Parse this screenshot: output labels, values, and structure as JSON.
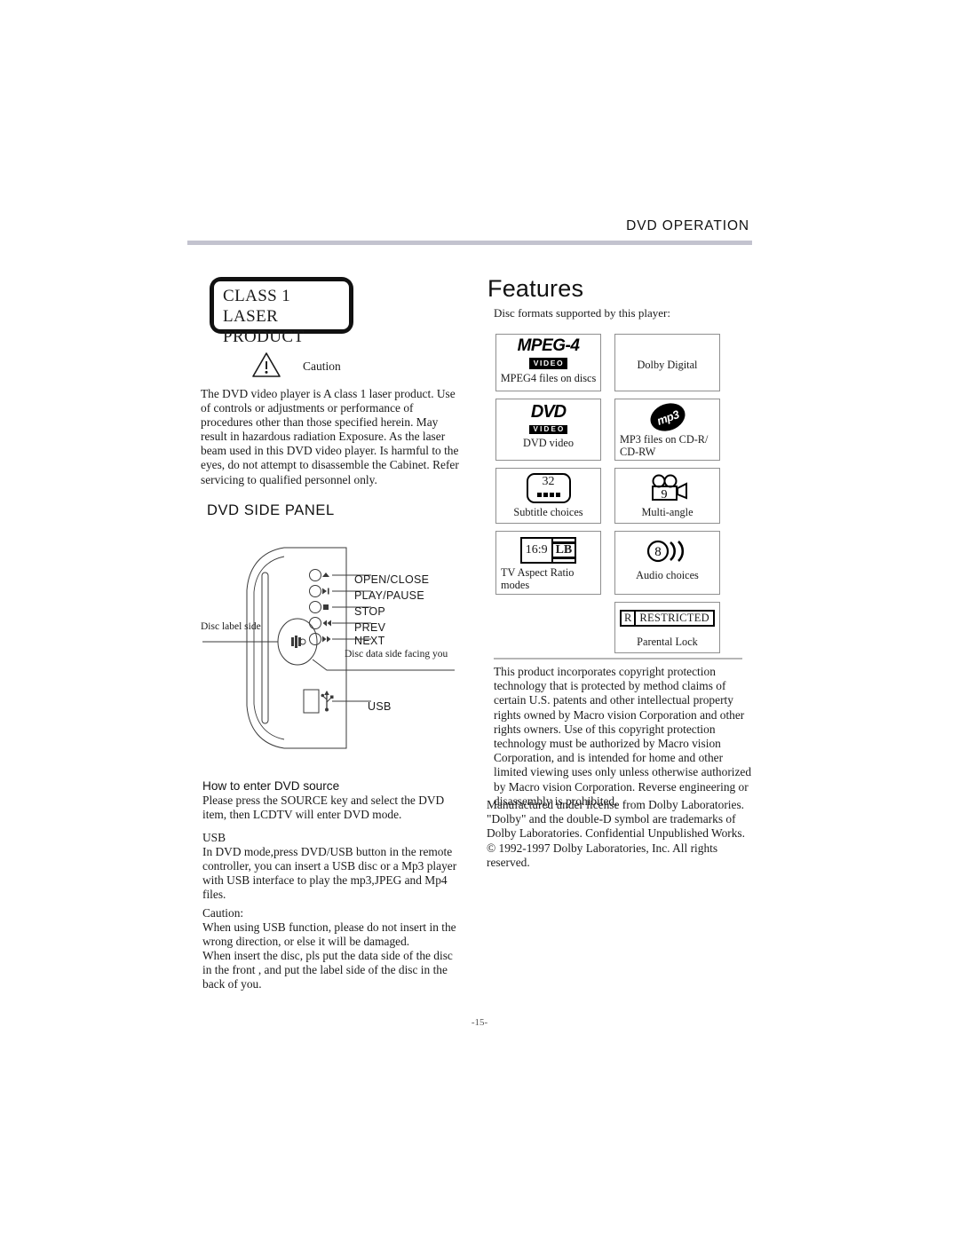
{
  "header": {
    "title": "DVD OPERATION"
  },
  "left": {
    "laser_badge": {
      "line1": "CLASS 1 LASER",
      "line2": "PRODUCT"
    },
    "caution_label": "Caution",
    "caution_icon": "warning-triangle-icon",
    "laser_paragraph": "The DVD video player is A class 1 laser product. Use of controls or adjustments or performance of procedures other than those specified herein. May result in hazardous radiation Exposure. As the laser beam used in this DVD video player. Is harmful to the eyes, do not attempt to disassemble the Cabinet. Refer servicing to qualified personnel only.",
    "side_panel_heading": "DVD SIDE PANEL",
    "panel": {
      "disc_label_side": "Disc label side",
      "disc_data_side": "Disc data side facing you",
      "buttons": [
        {
          "label": "OPEN/CLOSE",
          "icon": "eject-icon"
        },
        {
          "label": "PLAY/PAUSE",
          "icon": "play-pause-icon"
        },
        {
          "label": "STOP",
          "icon": "stop-icon"
        },
        {
          "label": "PREV",
          "icon": "previous-icon"
        },
        {
          "label": "NEXT",
          "icon": "next-icon"
        }
      ],
      "usb_label": "USB",
      "usb_icon": "usb-icon"
    },
    "howto": {
      "heading": "How to enter DVD source",
      "body": "Please press the SOURCE key and  select the DVD item, then  LCDTV  will enter DVD mode."
    },
    "usb_section": {
      "heading": "USB",
      "body": "In DVD mode,press DVD/USB button in the  remote  controller, you can  insert a USB disc or a Mp3 player with USB interface  to play the mp3,JPEG and Mp4  files."
    },
    "caution_section": {
      "heading": "Caution:",
      "body1": "When using USB function, please do not insert  in the  wrong direction, or else it will be damaged.",
      "body2": "When insert the disc, pls put the data side of the disc in the front , and put the label side of the disc in the back of you."
    }
  },
  "right": {
    "features_title": "Features",
    "features_intro": "Disc formats supported by this player:",
    "feature_cells": [
      {
        "label": "MPEG4  files on discs",
        "icon": "mpeg4-video-logo",
        "logo_top": "MPEG-4",
        "logo_bottom": "VIDEO"
      },
      {
        "label": "Dolby Digital",
        "icon": "dolby-digital-logo"
      },
      {
        "label": "DVD video",
        "icon": "dvd-video-logo",
        "logo_top": "DVD",
        "logo_bottom": "VIDEO"
      },
      {
        "label": "MP3 files on CD-R/ CD-RW",
        "icon": "mp3-logo",
        "logo_text": "mp3"
      },
      {
        "label": "Subtitle choices",
        "icon": "subtitle-icon",
        "value": "32"
      },
      {
        "label": "Multi-angle",
        "icon": "multi-angle-camera-icon",
        "value": "9"
      },
      {
        "label": "TV Aspect Ratio modes",
        "icon": "aspect-ratio-icon",
        "value_left": "16:9",
        "value_right": "LB"
      },
      {
        "label": "Audio choices",
        "icon": "audio-choices-icon",
        "value": "8"
      },
      {
        "label": "Parental  Lock",
        "icon": "restricted-rating-icon",
        "value_left": "R",
        "value_right": "RESTRICTED"
      }
    ],
    "macrovision_paragraph": "This product incorporates copyright protection technology that is protected by method  claims of certain U.S. patents and other intellectual property rights owned by Macro vision Corporation and other rights owners. Use of this copyright protection technology must be authorized by Macro vision Corporation, and is intended for home and other limited viewing uses only unless  otherwise authorized by Macro vision Corporation. Reverse engineering or disassembly is prohibited.",
    "dolby_paragraph": "Manufactured under license from Dolby Laboratories. \"Dolby\" and the double-D symbol are trademarks  of Dolby Laboratories. Confidential Unpublished Works. © 1992-1997  Dolby Laboratories, Inc. All rights  reserved."
  },
  "footer": {
    "page_number": "-15-"
  },
  "colors": {
    "header_rule": "#c3c3cf",
    "cell_border": "#8f8f8f",
    "ink": "#1a1a1a"
  }
}
